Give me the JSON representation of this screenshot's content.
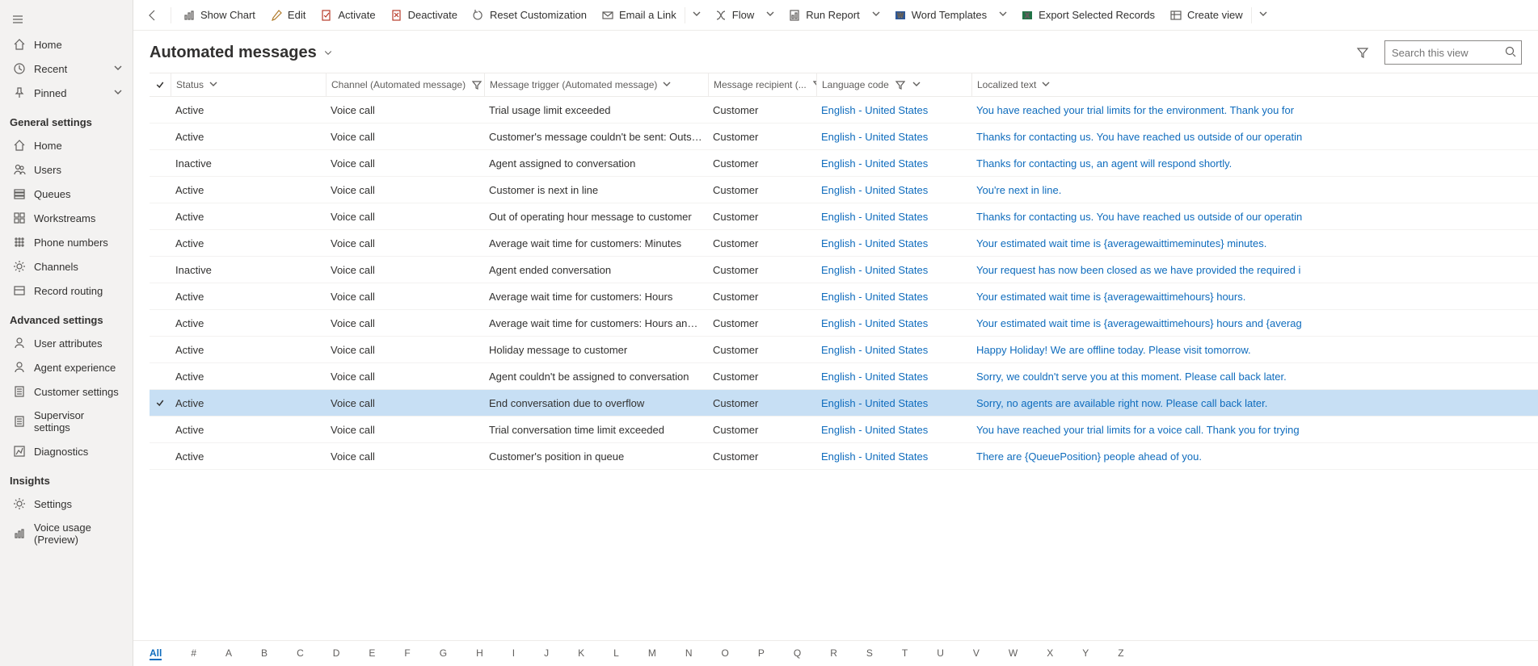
{
  "sidebar": {
    "top": [
      {
        "icon": "home",
        "label": "Home"
      },
      {
        "icon": "clock",
        "label": "Recent",
        "chev": true
      },
      {
        "icon": "pin",
        "label": "Pinned",
        "chev": true
      }
    ],
    "groups": [
      {
        "title": "General settings",
        "items": [
          {
            "icon": "home",
            "label": "Home"
          },
          {
            "icon": "users",
            "label": "Users"
          },
          {
            "icon": "queues",
            "label": "Queues"
          },
          {
            "icon": "work",
            "label": "Workstreams"
          },
          {
            "icon": "phone",
            "label": "Phone numbers"
          },
          {
            "icon": "gear",
            "label": "Channels"
          },
          {
            "icon": "route",
            "label": "Record routing"
          }
        ]
      },
      {
        "title": "Advanced settings",
        "items": [
          {
            "icon": "person",
            "label": "User attributes"
          },
          {
            "icon": "person",
            "label": "Agent experience"
          },
          {
            "icon": "doc",
            "label": "Customer settings"
          },
          {
            "icon": "doc",
            "label": "Supervisor settings"
          },
          {
            "icon": "diag",
            "label": "Diagnostics"
          }
        ]
      },
      {
        "title": "Insights",
        "items": [
          {
            "icon": "gear",
            "label": "Settings"
          },
          {
            "icon": "chart",
            "label": "Voice usage (Preview)"
          }
        ]
      }
    ]
  },
  "commands": [
    {
      "icon": "chart",
      "label": "Show Chart"
    },
    {
      "icon": "edit",
      "label": "Edit"
    },
    {
      "icon": "activate",
      "label": "Activate"
    },
    {
      "icon": "deactivate",
      "label": "Deactivate"
    },
    {
      "icon": "reset",
      "label": "Reset Customization"
    },
    {
      "icon": "mail",
      "label": "Email a Link",
      "split": true
    },
    {
      "icon": "flow",
      "label": "Flow",
      "drop": true
    },
    {
      "icon": "report",
      "label": "Run Report",
      "drop": true
    },
    {
      "icon": "word",
      "label": "Word Templates",
      "drop": true
    },
    {
      "icon": "excel",
      "label": "Export Selected Records"
    },
    {
      "icon": "view",
      "label": "Create view",
      "split": true
    }
  ],
  "view": {
    "title": "Automated messages",
    "search_placeholder": "Search this view"
  },
  "columns": {
    "status": "Status",
    "channel": "Channel (Automated message)",
    "trigger": "Message trigger (Automated message)",
    "recipient": "Message recipient (...",
    "lang": "Language code",
    "text": "Localized text"
  },
  "rows": [
    {
      "status": "Active",
      "channel": "Voice call",
      "trigger": "Trial usage limit exceeded",
      "recipient": "Customer",
      "lang": "English - United States",
      "text": "You have reached your trial limits for the environment. Thank you for"
    },
    {
      "status": "Active",
      "channel": "Voice call",
      "trigger": "Customer's message couldn't be sent: Outside ...",
      "recipient": "Customer",
      "lang": "English - United States",
      "text": "Thanks for contacting us. You have reached us outside of our operatin"
    },
    {
      "status": "Inactive",
      "channel": "Voice call",
      "trigger": "Agent assigned to conversation",
      "recipient": "Customer",
      "lang": "English - United States",
      "text": "Thanks for contacting us, an agent will respond shortly."
    },
    {
      "status": "Active",
      "channel": "Voice call",
      "trigger": "Customer is next in line",
      "recipient": "Customer",
      "lang": "English - United States",
      "text": "You're next in line."
    },
    {
      "status": "Active",
      "channel": "Voice call",
      "trigger": "Out of operating hour message to customer",
      "recipient": "Customer",
      "lang": "English - United States",
      "text": "Thanks for contacting us. You have reached us outside of our operatin"
    },
    {
      "status": "Active",
      "channel": "Voice call",
      "trigger": "Average wait time for customers: Minutes",
      "recipient": "Customer",
      "lang": "English - United States",
      "text": "Your estimated wait time is {averagewaittimeminutes} minutes."
    },
    {
      "status": "Inactive",
      "channel": "Voice call",
      "trigger": "Agent ended conversation",
      "recipient": "Customer",
      "lang": "English - United States",
      "text": "Your request has now been closed as we have provided the required i"
    },
    {
      "status": "Active",
      "channel": "Voice call",
      "trigger": "Average wait time for customers: Hours",
      "recipient": "Customer",
      "lang": "English - United States",
      "text": "Your estimated wait time is {averagewaittimehours} hours."
    },
    {
      "status": "Active",
      "channel": "Voice call",
      "trigger": "Average wait time for customers: Hours and mi...",
      "recipient": "Customer",
      "lang": "English - United States",
      "text": "Your estimated wait time is {averagewaittimehours} hours and {averag"
    },
    {
      "status": "Active",
      "channel": "Voice call",
      "trigger": "Holiday message to customer",
      "recipient": "Customer",
      "lang": "English - United States",
      "text": "Happy Holiday! We are offline today. Please visit tomorrow."
    },
    {
      "status": "Active",
      "channel": "Voice call",
      "trigger": "Agent couldn't be assigned to conversation",
      "recipient": "Customer",
      "lang": "English - United States",
      "text": "Sorry, we couldn't serve you at this moment. Please call back later."
    },
    {
      "status": "Active",
      "channel": "Voice call",
      "trigger": "End conversation due to overflow",
      "recipient": "Customer",
      "lang": "English - United States",
      "text": "Sorry, no agents are available right now. Please call back later.",
      "selected": true
    },
    {
      "status": "Active",
      "channel": "Voice call",
      "trigger": "Trial conversation time limit exceeded",
      "recipient": "Customer",
      "lang": "English - United States",
      "text": "You have reached your trial limits for a voice call. Thank you for trying"
    },
    {
      "status": "Active",
      "channel": "Voice call",
      "trigger": "Customer's position in queue",
      "recipient": "Customer",
      "lang": "English - United States",
      "text": "There are {QueuePosition} people ahead of you."
    }
  ],
  "jumpbar": [
    "All",
    "#",
    "A",
    "B",
    "C",
    "D",
    "E",
    "F",
    "G",
    "H",
    "I",
    "J",
    "K",
    "L",
    "M",
    "N",
    "O",
    "P",
    "Q",
    "R",
    "S",
    "T",
    "U",
    "V",
    "W",
    "X",
    "Y",
    "Z"
  ]
}
